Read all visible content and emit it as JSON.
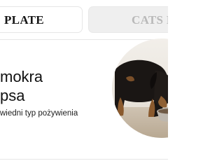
{
  "tabs": [
    {
      "label": "PLATE",
      "active": true
    },
    {
      "label": "CATS P",
      "active": false
    }
  ],
  "hero": {
    "headline_line1": "mokra",
    "headline_line2": "psa",
    "subtext": "wiedni typ pożywienia",
    "image": "dog-eating-from-bowl"
  },
  "colors": {
    "tab_active_text": "#151515",
    "tab_inactive_text": "#b9b9b9",
    "tab_inactive_bg": "#efefef"
  }
}
